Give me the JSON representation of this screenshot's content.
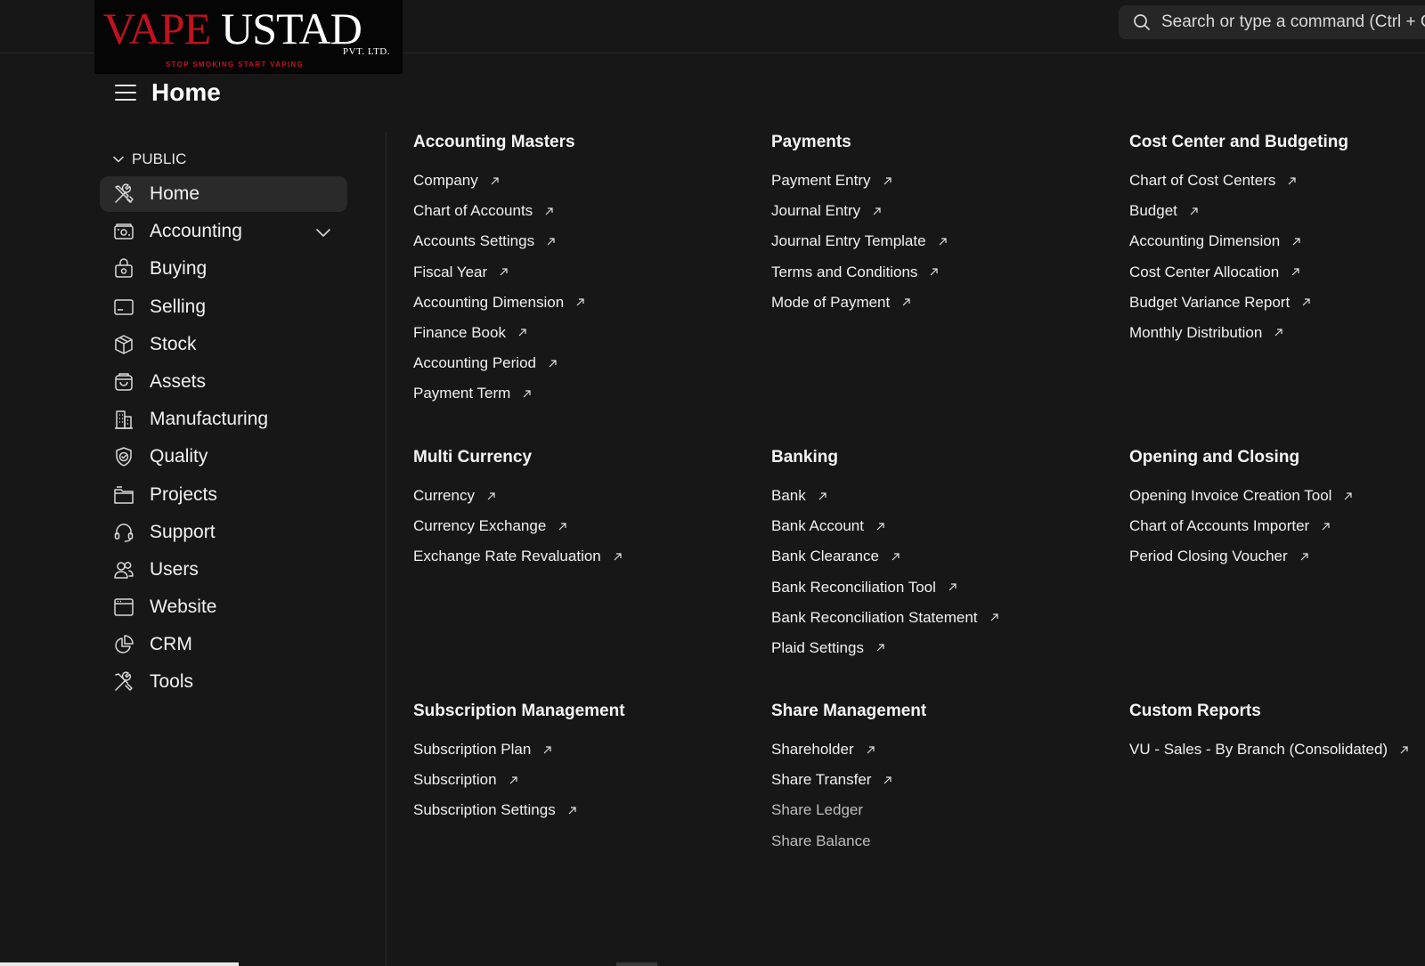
{
  "brand": {
    "name_part1": "VAPE",
    "name_part2": "USTAD",
    "suffix": "PVT. LTD.",
    "tagline": "STOP SMOKING  START VAPING",
    "accent_color": "#c1121f"
  },
  "search": {
    "placeholder": "Search or type a command (Ctrl + G)",
    "icon": "search-icon"
  },
  "page": {
    "title": "Home",
    "menu_icon": "hamburger-icon"
  },
  "sidebar": {
    "section_label": "PUBLIC",
    "items": [
      {
        "label": "Home",
        "icon": "tools-icon",
        "active": true
      },
      {
        "label": "Accounting",
        "icon": "wallet-icon",
        "expandable": true
      },
      {
        "label": "Buying",
        "icon": "shopping-bag-icon"
      },
      {
        "label": "Selling",
        "icon": "card-icon"
      },
      {
        "label": "Stock",
        "icon": "box-icon"
      },
      {
        "label": "Assets",
        "icon": "basket-icon"
      },
      {
        "label": "Manufacturing",
        "icon": "factory-icon"
      },
      {
        "label": "Quality",
        "icon": "shield-check-icon"
      },
      {
        "label": "Projects",
        "icon": "folder-icon"
      },
      {
        "label": "Support",
        "icon": "headset-icon"
      },
      {
        "label": "Users",
        "icon": "users-icon"
      },
      {
        "label": "Website",
        "icon": "browser-icon"
      },
      {
        "label": "CRM",
        "icon": "pie-chart-icon"
      },
      {
        "label": "Tools",
        "icon": "wrench-icon"
      }
    ]
  },
  "cards": [
    {
      "title": "Accounting Masters",
      "links": [
        {
          "label": "Company"
        },
        {
          "label": "Chart of Accounts"
        },
        {
          "label": "Accounts Settings"
        },
        {
          "label": "Fiscal Year"
        },
        {
          "label": "Accounting Dimension"
        },
        {
          "label": "Finance Book"
        },
        {
          "label": "Accounting Period"
        },
        {
          "label": "Payment Term"
        }
      ]
    },
    {
      "title": "Payments",
      "links": [
        {
          "label": "Payment Entry"
        },
        {
          "label": "Journal Entry"
        },
        {
          "label": "Journal Entry Template"
        },
        {
          "label": "Terms and Conditions"
        },
        {
          "label": "Mode of Payment"
        }
      ]
    },
    {
      "title": "Cost Center and Budgeting",
      "links": [
        {
          "label": "Chart of Cost Centers"
        },
        {
          "label": "Budget"
        },
        {
          "label": "Accounting Dimension"
        },
        {
          "label": "Cost Center Allocation"
        },
        {
          "label": "Budget Variance Report"
        },
        {
          "label": "Monthly Distribution"
        }
      ]
    },
    {
      "title": "Multi Currency",
      "links": [
        {
          "label": "Currency"
        },
        {
          "label": "Currency Exchange"
        },
        {
          "label": "Exchange Rate Revaluation"
        }
      ]
    },
    {
      "title": "Banking",
      "links": [
        {
          "label": "Bank"
        },
        {
          "label": "Bank Account"
        },
        {
          "label": "Bank Clearance"
        },
        {
          "label": "Bank Reconciliation Tool"
        },
        {
          "label": "Bank Reconciliation Statement"
        },
        {
          "label": "Plaid Settings"
        }
      ]
    },
    {
      "title": "Opening and Closing",
      "links": [
        {
          "label": "Opening Invoice Creation Tool"
        },
        {
          "label": "Chart of Accounts Importer"
        },
        {
          "label": "Period Closing Voucher"
        }
      ]
    },
    {
      "title": "Subscription Management",
      "links": [
        {
          "label": "Subscription Plan"
        },
        {
          "label": "Subscription"
        },
        {
          "label": "Subscription Settings"
        }
      ]
    },
    {
      "title": "Share Management",
      "links": [
        {
          "label": "Shareholder"
        },
        {
          "label": "Share Transfer"
        },
        {
          "label": "Share Ledger",
          "dim": true
        },
        {
          "label": "Share Balance",
          "dim": true
        }
      ]
    },
    {
      "title": "Custom Reports",
      "links": [
        {
          "label": "VU - Sales - By Branch (Consolidated)"
        }
      ]
    }
  ]
}
